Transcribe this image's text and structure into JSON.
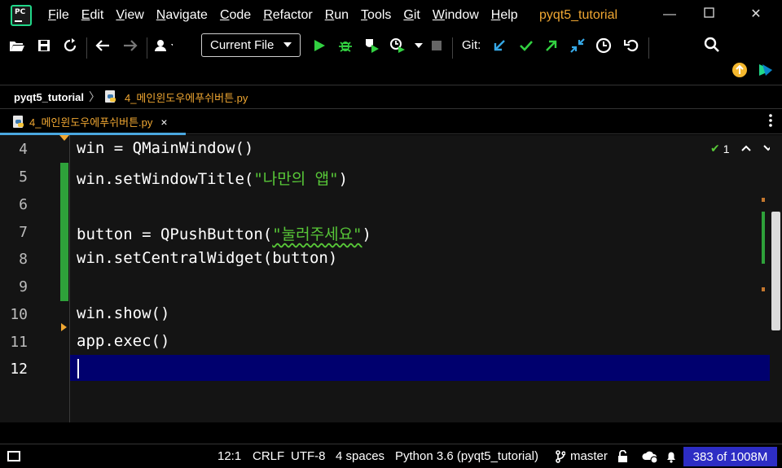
{
  "menubar": {
    "items": [
      {
        "label": "File",
        "u": "F",
        "rest": "ile"
      },
      {
        "label": "Edit",
        "u": "E",
        "rest": "dit"
      },
      {
        "label": "View",
        "u": "V",
        "rest": "iew"
      },
      {
        "label": "Navigate",
        "u": "N",
        "rest": "avigate"
      },
      {
        "label": "Code",
        "u": "C",
        "rest": "ode"
      },
      {
        "label": "Refactor",
        "u": "R",
        "rest": "efactor"
      },
      {
        "label": "Run",
        "u": "R",
        "rest": "un"
      },
      {
        "label": "Tools",
        "u": "T",
        "rest": "ools"
      },
      {
        "label": "Git",
        "u": "G",
        "rest": "it"
      },
      {
        "label": "Window",
        "u": "W",
        "rest": "indow"
      },
      {
        "label": "Help",
        "u": "H",
        "rest": "elp"
      }
    ],
    "project_title": "pyqt5_tutorial",
    "logo_text": "PC"
  },
  "toolbar": {
    "run_config": "Current File",
    "git_label": "Git:"
  },
  "breadcrumb": {
    "project": "pyqt5_tutorial",
    "separator": "〉",
    "file": "4_메인윈도우에푸쉬버튼.py"
  },
  "tab": {
    "label": "4_메인윈도우에푸쉬버튼.py",
    "close": "×"
  },
  "editor": {
    "lines": [
      {
        "num": "4",
        "code": "win = QMainWindow()"
      },
      {
        "num": "5",
        "pre": "win.setWindowTitle(",
        "str": "\"나만의 앱\"",
        "post": ")"
      },
      {
        "num": "6",
        "code": ""
      },
      {
        "num": "7",
        "pre": "button = QPushButton(",
        "str": "\"눌러주세요\"",
        "post": ")"
      },
      {
        "num": "8",
        "code": "win.setCentralWidget(button)"
      },
      {
        "num": "9",
        "code": ""
      },
      {
        "num": "10",
        "code": "win.show()"
      },
      {
        "num": "11",
        "code": "app.exec()"
      },
      {
        "num": "12",
        "code": ""
      }
    ],
    "inspection_count": "1"
  },
  "statusbar": {
    "position": "12:1",
    "line_sep": "CRLF",
    "encoding": "UTF-8",
    "indent": "4 spaces",
    "interpreter": "Python 3.6 (pyqt5_tutorial)",
    "branch": "master",
    "memory": "383 of 1008M"
  },
  "colors": {
    "accent_orange": "#f0a732",
    "string_green": "#58c838",
    "current_line": "#00006e",
    "memory_bg": "#2d2dc4"
  }
}
